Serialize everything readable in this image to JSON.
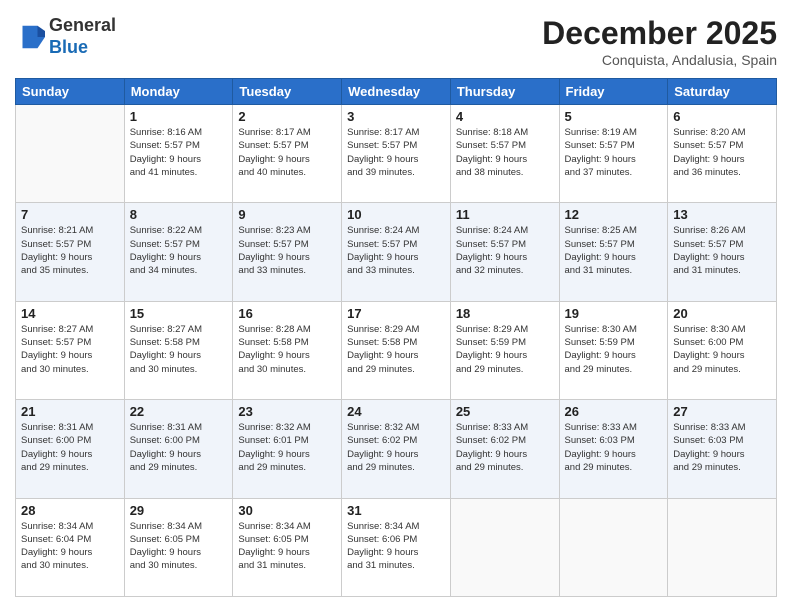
{
  "header": {
    "logo_line1": "General",
    "logo_line2": "Blue",
    "month_year": "December 2025",
    "location": "Conquista, Andalusia, Spain"
  },
  "days_of_week": [
    "Sunday",
    "Monday",
    "Tuesday",
    "Wednesday",
    "Thursday",
    "Friday",
    "Saturday"
  ],
  "weeks": [
    [
      {
        "day": "",
        "info": ""
      },
      {
        "day": "1",
        "info": "Sunrise: 8:16 AM\nSunset: 5:57 PM\nDaylight: 9 hours\nand 41 minutes."
      },
      {
        "day": "2",
        "info": "Sunrise: 8:17 AM\nSunset: 5:57 PM\nDaylight: 9 hours\nand 40 minutes."
      },
      {
        "day": "3",
        "info": "Sunrise: 8:17 AM\nSunset: 5:57 PM\nDaylight: 9 hours\nand 39 minutes."
      },
      {
        "day": "4",
        "info": "Sunrise: 8:18 AM\nSunset: 5:57 PM\nDaylight: 9 hours\nand 38 minutes."
      },
      {
        "day": "5",
        "info": "Sunrise: 8:19 AM\nSunset: 5:57 PM\nDaylight: 9 hours\nand 37 minutes."
      },
      {
        "day": "6",
        "info": "Sunrise: 8:20 AM\nSunset: 5:57 PM\nDaylight: 9 hours\nand 36 minutes."
      }
    ],
    [
      {
        "day": "7",
        "info": "Sunrise: 8:21 AM\nSunset: 5:57 PM\nDaylight: 9 hours\nand 35 minutes."
      },
      {
        "day": "8",
        "info": "Sunrise: 8:22 AM\nSunset: 5:57 PM\nDaylight: 9 hours\nand 34 minutes."
      },
      {
        "day": "9",
        "info": "Sunrise: 8:23 AM\nSunset: 5:57 PM\nDaylight: 9 hours\nand 33 minutes."
      },
      {
        "day": "10",
        "info": "Sunrise: 8:24 AM\nSunset: 5:57 PM\nDaylight: 9 hours\nand 33 minutes."
      },
      {
        "day": "11",
        "info": "Sunrise: 8:24 AM\nSunset: 5:57 PM\nDaylight: 9 hours\nand 32 minutes."
      },
      {
        "day": "12",
        "info": "Sunrise: 8:25 AM\nSunset: 5:57 PM\nDaylight: 9 hours\nand 31 minutes."
      },
      {
        "day": "13",
        "info": "Sunrise: 8:26 AM\nSunset: 5:57 PM\nDaylight: 9 hours\nand 31 minutes."
      }
    ],
    [
      {
        "day": "14",
        "info": "Sunrise: 8:27 AM\nSunset: 5:57 PM\nDaylight: 9 hours\nand 30 minutes."
      },
      {
        "day": "15",
        "info": "Sunrise: 8:27 AM\nSunset: 5:58 PM\nDaylight: 9 hours\nand 30 minutes."
      },
      {
        "day": "16",
        "info": "Sunrise: 8:28 AM\nSunset: 5:58 PM\nDaylight: 9 hours\nand 30 minutes."
      },
      {
        "day": "17",
        "info": "Sunrise: 8:29 AM\nSunset: 5:58 PM\nDaylight: 9 hours\nand 29 minutes."
      },
      {
        "day": "18",
        "info": "Sunrise: 8:29 AM\nSunset: 5:59 PM\nDaylight: 9 hours\nand 29 minutes."
      },
      {
        "day": "19",
        "info": "Sunrise: 8:30 AM\nSunset: 5:59 PM\nDaylight: 9 hours\nand 29 minutes."
      },
      {
        "day": "20",
        "info": "Sunrise: 8:30 AM\nSunset: 6:00 PM\nDaylight: 9 hours\nand 29 minutes."
      }
    ],
    [
      {
        "day": "21",
        "info": "Sunrise: 8:31 AM\nSunset: 6:00 PM\nDaylight: 9 hours\nand 29 minutes."
      },
      {
        "day": "22",
        "info": "Sunrise: 8:31 AM\nSunset: 6:00 PM\nDaylight: 9 hours\nand 29 minutes."
      },
      {
        "day": "23",
        "info": "Sunrise: 8:32 AM\nSunset: 6:01 PM\nDaylight: 9 hours\nand 29 minutes."
      },
      {
        "day": "24",
        "info": "Sunrise: 8:32 AM\nSunset: 6:02 PM\nDaylight: 9 hours\nand 29 minutes."
      },
      {
        "day": "25",
        "info": "Sunrise: 8:33 AM\nSunset: 6:02 PM\nDaylight: 9 hours\nand 29 minutes."
      },
      {
        "day": "26",
        "info": "Sunrise: 8:33 AM\nSunset: 6:03 PM\nDaylight: 9 hours\nand 29 minutes."
      },
      {
        "day": "27",
        "info": "Sunrise: 8:33 AM\nSunset: 6:03 PM\nDaylight: 9 hours\nand 29 minutes."
      }
    ],
    [
      {
        "day": "28",
        "info": "Sunrise: 8:34 AM\nSunset: 6:04 PM\nDaylight: 9 hours\nand 30 minutes."
      },
      {
        "day": "29",
        "info": "Sunrise: 8:34 AM\nSunset: 6:05 PM\nDaylight: 9 hours\nand 30 minutes."
      },
      {
        "day": "30",
        "info": "Sunrise: 8:34 AM\nSunset: 6:05 PM\nDaylight: 9 hours\nand 31 minutes."
      },
      {
        "day": "31",
        "info": "Sunrise: 8:34 AM\nSunset: 6:06 PM\nDaylight: 9 hours\nand 31 minutes."
      },
      {
        "day": "",
        "info": ""
      },
      {
        "day": "",
        "info": ""
      },
      {
        "day": "",
        "info": ""
      }
    ]
  ]
}
